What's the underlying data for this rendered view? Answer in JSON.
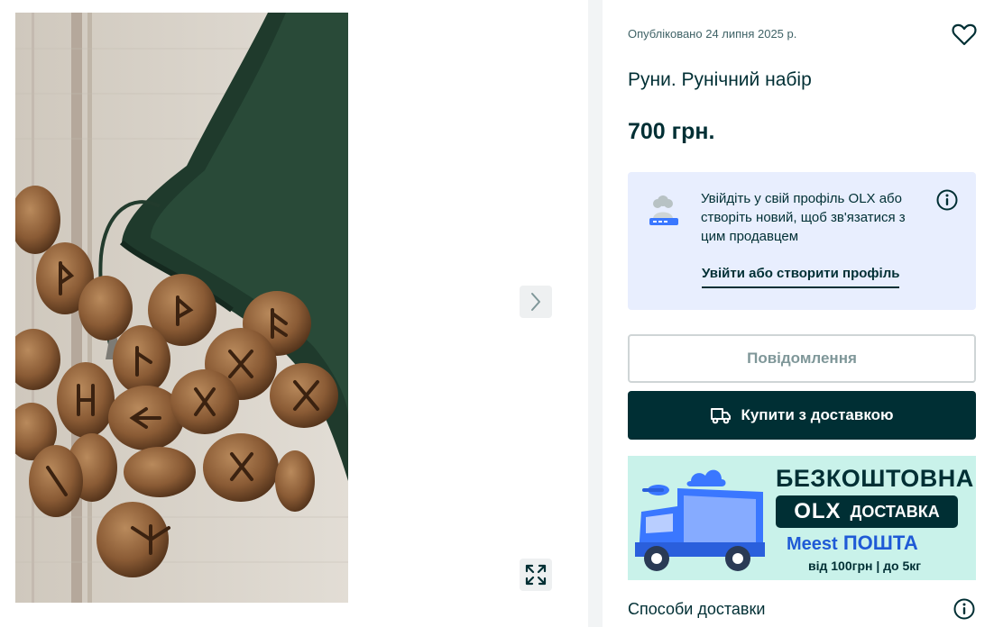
{
  "gallery": {
    "photo_alt": "Руни. Рунічний набір",
    "next_icon": "chevron-right-icon",
    "expand_icon": "expand-icon"
  },
  "listing": {
    "published": "Опубліковано 24 липня 2025 р.",
    "title": "Руни. Рунічний набір",
    "price": "700 грн.",
    "favorite_icon": "heart-icon"
  },
  "login_card": {
    "text": "Увійдіть у свій профіль OLX або створіть новий, щоб зв'язатися з цим продавцем",
    "link": "Увійти або створити профіль",
    "info_icon": "info-icon"
  },
  "actions": {
    "message_label": "Повідомлення",
    "buy_label": "Купити з доставкою",
    "buy_icon": "truck-icon"
  },
  "banner": {
    "headline": "БЕЗКОШТОВНА",
    "brand": "OLX",
    "delivery_word": "ДОСТАВКА",
    "meest": "Meest",
    "post_word": "ПОШТА",
    "terms": "від 100грн | до 5кг"
  },
  "delivery": {
    "title": "Способи доставки"
  },
  "colors": {
    "primary": "#002f34",
    "login_card_bg": "#e8eefe",
    "banner_bg": "#c9f2ea",
    "meest_blue": "#1f5ad6"
  }
}
